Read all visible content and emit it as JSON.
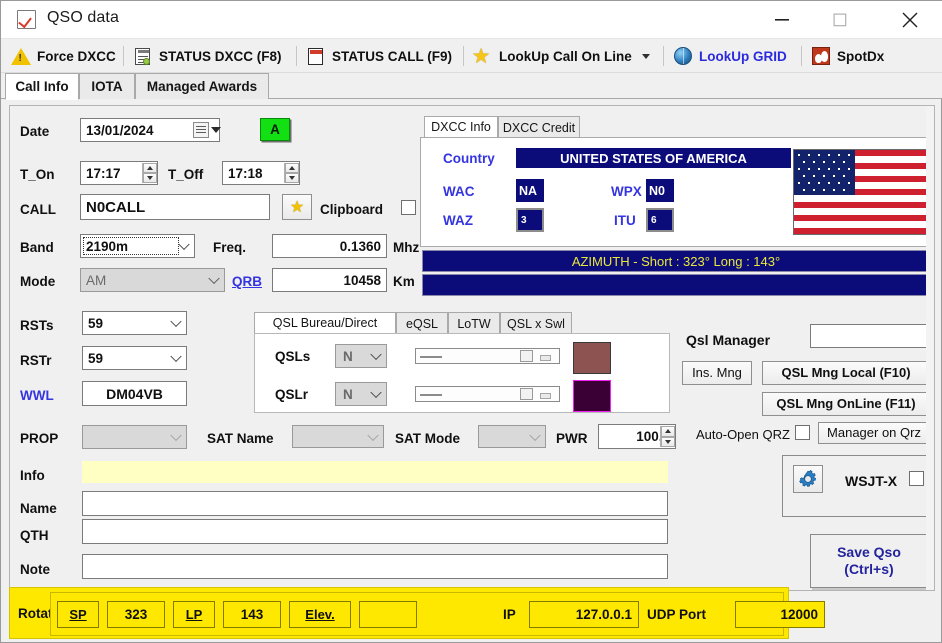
{
  "window": {
    "title": "QSO data",
    "icon": "checklist-icon",
    "minimize": "minimize",
    "maximize": "maximize",
    "close": "close"
  },
  "toolbar": {
    "items": [
      {
        "label": "Force DXCC",
        "icon": "warning-triangle-icon"
      },
      {
        "label": "STATUS DXCC (F8)",
        "icon": "document-status-icon"
      },
      {
        "label": "STATUS CALL (F9)",
        "icon": "document-red-icon"
      },
      {
        "label": "LookUp Call On Line",
        "icon": "star-icon",
        "has_dropdown": true
      },
      {
        "label": "LookUp GRID",
        "icon": "globe-icon"
      },
      {
        "label": "SpotDx",
        "icon": "spotdx-icon"
      }
    ]
  },
  "tabs": [
    {
      "label": "Call Info",
      "active": true
    },
    {
      "label": "IOTA",
      "active": false
    },
    {
      "label": "Managed Awards",
      "active": false
    }
  ],
  "form": {
    "date_label": "Date",
    "date_value": "13/01/2024",
    "auto_button": "A",
    "t_on_label": "T_On",
    "t_on_value": "17:17",
    "t_off_label": "T_Off",
    "t_off_value": "17:18",
    "call_label": "CALL",
    "call_value": "N0CALL",
    "clipboard_label": "Clipboard",
    "band_label": "Band",
    "band_value": "2190m",
    "freq_label": "Freq.",
    "freq_value": "0.1360",
    "freq_unit": "Mhz",
    "mode_label": "Mode",
    "mode_value": "AM",
    "qrb_label": "QRB",
    "qrb_value": "10458",
    "qrb_unit": "Km",
    "rsts_label": "RSTs",
    "rsts_value": "59",
    "rstr_label": "RSTr",
    "rstr_value": "59",
    "wwl_label": "WWL",
    "wwl_value": "DM04VB",
    "prop_label": "PROP",
    "prop_value": "",
    "sat_name_label": "SAT Name",
    "sat_name_value": "",
    "sat_mode_label": "SAT Mode",
    "sat_mode_value": "",
    "pwr_label": "PWR",
    "pwr_value": "100,0",
    "info_label": "Info",
    "info_value": "",
    "name_label": "Name",
    "name_value": "",
    "qth_label": "QTH",
    "qth_value": "",
    "note_label": "Note",
    "note_value": ""
  },
  "dxcc": {
    "tabs": [
      {
        "label": "DXCC Info",
        "active": true
      },
      {
        "label": "DXCC Credit",
        "active": false
      }
    ],
    "country_label": "Country",
    "country_value": "UNITED STATES OF AMERICA",
    "wac_label": "WAC",
    "wac_value": "NA",
    "wpx_label": "WPX",
    "wpx_value": "N0",
    "waz_label": "WAZ",
    "waz_value": "3",
    "itu_label": "ITU",
    "itu_value": "6",
    "flag": "united-states-flag",
    "azimuth": "AZIMUTH - Short : 323° Long : 143°",
    "azimuth_second": ""
  },
  "qsl": {
    "tabs": [
      {
        "label": "QSL Bureau/Direct",
        "active": true
      },
      {
        "label": "eQSL",
        "active": false
      },
      {
        "label": "LoTW",
        "active": false
      },
      {
        "label": "QSL x Swl",
        "active": false
      }
    ],
    "qsls_label": "QSLs",
    "qsls_value": "N",
    "qslr_label": "QSLr",
    "qslr_value": "N",
    "qsls_color": "#8d5350",
    "qslr_color": "#3a0035"
  },
  "manager": {
    "title": "Qsl Manager",
    "value": "",
    "ins_button": "Ins. Mng",
    "local_button": "QSL Mng Local (F10)",
    "online_button": "QSL Mng OnLine (F11)",
    "auto_open_label": "Auto-Open QRZ",
    "manager_on_qrz": "Manager on Qrz"
  },
  "wsjt": {
    "label": "WSJT-X",
    "gear_icon": "gear-icon"
  },
  "save": {
    "line1": "Save Qso",
    "line2": "(Ctrl+s)"
  },
  "rotator": {
    "label": "Rotator",
    "sp_button": "SP",
    "sp_value": "323",
    "lp_button": "LP",
    "lp_value": "143",
    "elev_button": "Elev.",
    "elev_value": "",
    "ip_label": "IP",
    "ip_value": "127.0.0.1",
    "udp_label": "UDP Port",
    "udp_value": "12000"
  },
  "colors": {
    "navy": "#0b0b7a",
    "yellow_bar": "#ffe800",
    "accent_blue": "#3434e0",
    "green": "#12e012",
    "info_yellow": "#ffffc4"
  }
}
